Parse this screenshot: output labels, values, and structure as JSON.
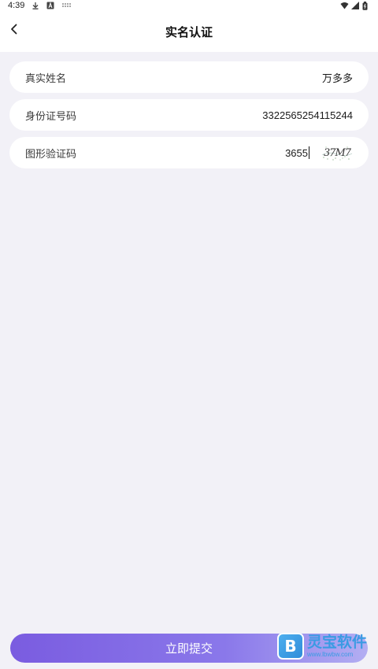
{
  "status_bar": {
    "time": "4:39",
    "left_icons": [
      "download-icon",
      "a-badge-icon",
      "signal-dots-icon"
    ],
    "right_icons": [
      "wifi-icon",
      "cell-signal-icon",
      "battery-icon"
    ]
  },
  "header": {
    "title": "实名认证",
    "back_icon": "chevron-left-icon"
  },
  "form": {
    "real_name": {
      "label": "真实姓名",
      "value": "万多多"
    },
    "id_number": {
      "label": "身份证号码",
      "value": "3322565254115244"
    },
    "captcha": {
      "label": "图形验证码",
      "value": "3655",
      "image_text": "37M7"
    }
  },
  "submit": {
    "label": "立即提交"
  },
  "watermark": {
    "name": "灵宝软件",
    "url": "www.lbwbw.com",
    "logo_letter": "B"
  },
  "colors": {
    "background": "#f2f1f7",
    "card": "#ffffff",
    "accent_start": "#7a5ce0",
    "accent_end": "#b3aef2",
    "watermark_blue": "#3a9be3"
  }
}
